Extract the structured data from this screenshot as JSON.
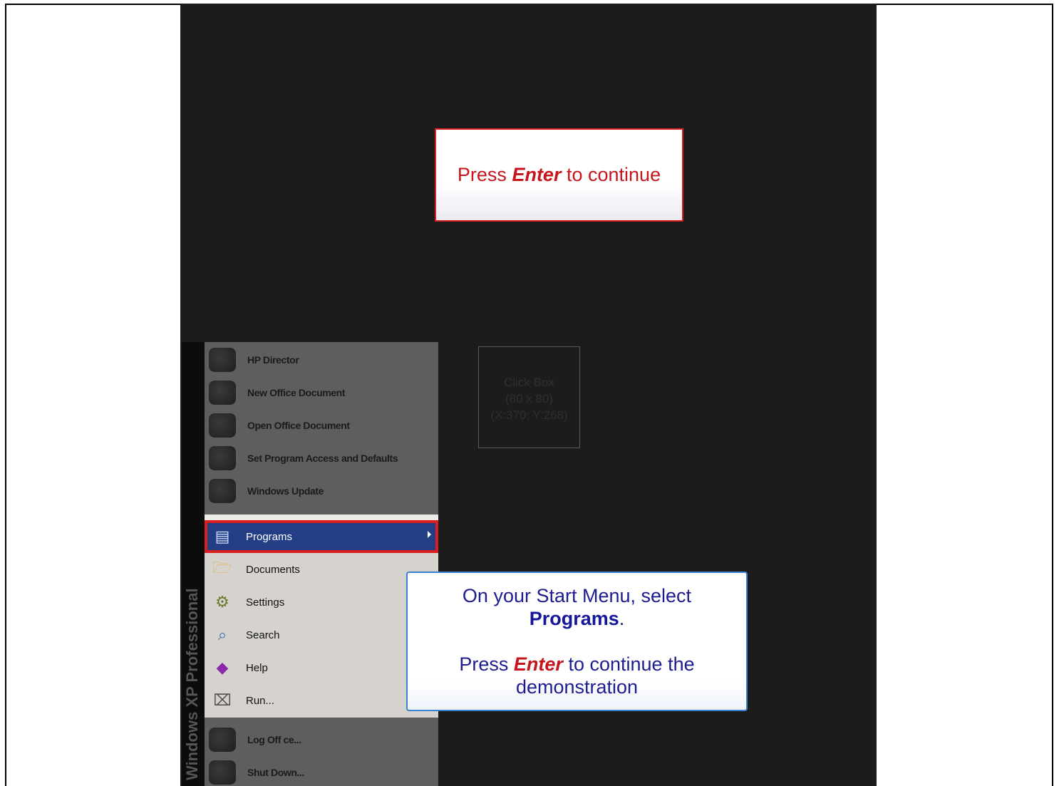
{
  "enter_box": {
    "prefix": "Press",
    "key": "Enter",
    "suffix": "to continue"
  },
  "click_box": {
    "line1": "Click Box",
    "line2": "(80 x 80)",
    "line3": "(X:370; Y:268)"
  },
  "start_menu": {
    "sidebar_text": "Windows XP Professional",
    "top_items": [
      {
        "label": "HP Director"
      },
      {
        "label": "New Office Document"
      },
      {
        "label": "Open Office Document"
      },
      {
        "label": "Set Program Access and Defaults"
      },
      {
        "label": "Windows Update"
      }
    ],
    "items": [
      {
        "label": "Programs",
        "icon": "programs-icon",
        "selected": true
      },
      {
        "label": "Documents",
        "icon": "documents-icon"
      },
      {
        "label": "Settings",
        "icon": "settings-icon"
      },
      {
        "label": "Search",
        "icon": "search-icon"
      },
      {
        "label": "Help",
        "icon": "help-icon"
      },
      {
        "label": "Run...",
        "icon": "run-icon"
      }
    ],
    "bottom_items": [
      {
        "label": "Log Off ce..."
      },
      {
        "label": "Shut Down..."
      }
    ]
  },
  "callout": {
    "line1": "On your Start Menu, select",
    "target": "Programs",
    "target_suffix": ".",
    "press": "Press",
    "key": "Enter",
    "continue": "to continue  the",
    "line4": "demonstration"
  },
  "colors": {
    "highlight_red": "#d81e1e",
    "menu_selected": "#243e85",
    "callout_text": "#1d1d8f"
  }
}
